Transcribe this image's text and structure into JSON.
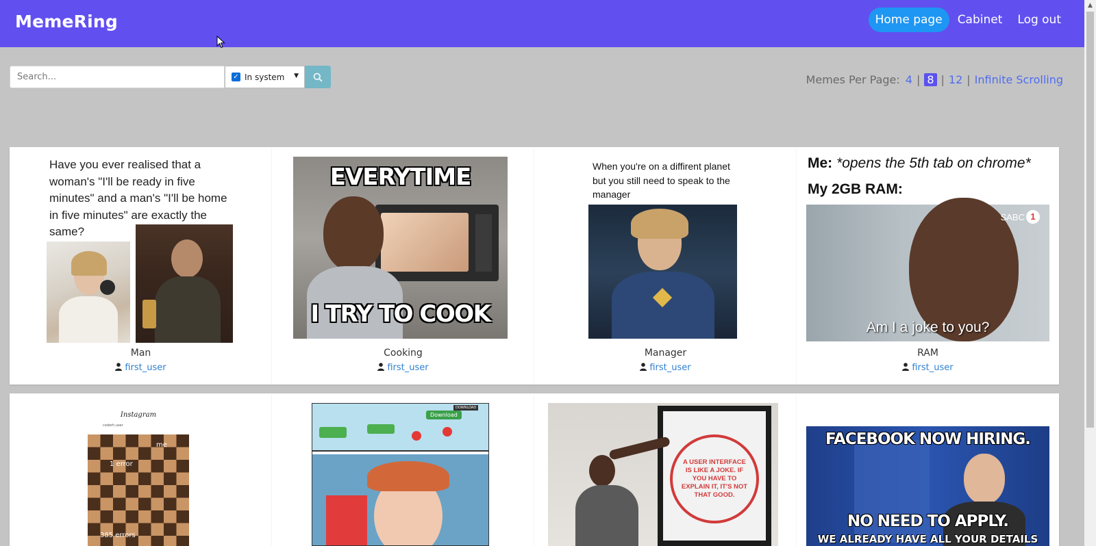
{
  "app": {
    "brand": "MemeRing"
  },
  "nav": {
    "home": "Home page",
    "cabinet": "Cabinet",
    "logout": "Log out"
  },
  "search": {
    "placeholder": "Search...",
    "filter_label": "In system"
  },
  "per_page": {
    "label": "Memes Per Page:",
    "options": [
      "4",
      "8",
      "12"
    ],
    "selected": "8",
    "infinite": "Infinite Scrolling"
  },
  "memes": [
    {
      "title": "Man",
      "author": "first_user",
      "caption": "Have you ever realised that a woman's \"I'll be ready in five minutes\" and a man's \"I'll be home in five minutes\" are exactly the same?"
    },
    {
      "title": "Cooking",
      "author": "first_user",
      "top_text": "EVERYTIME",
      "bottom_text": "I TRY TO COOK"
    },
    {
      "title": "Manager",
      "author": "first_user",
      "caption": "When you're on a diffirent planet but you still need to speak to the manager"
    },
    {
      "title": "RAM",
      "author": "first_user",
      "line1_label": "Me:",
      "line1_text": "*opens the 5th tab on chrome*",
      "line2": "My 2GB RAM:",
      "subtitle": "Am I a joke to you?",
      "channel": "SABC",
      "channel_num": "1"
    },
    {
      "app_header": "Instagram",
      "user_text": "coderh.user",
      "me_label": "me",
      "error_label": "1 error",
      "errors_label": "385 errors"
    },
    {
      "download_label": "Download",
      "sub_label": "DOWNLOAD"
    },
    {
      "poster_text": "A USER INTERFACE IS LIKE A JOKE. IF YOU HAVE TO EXPLAIN IT, IT'S NOT THAT GOOD."
    },
    {
      "top_text": "FACEBOOK NOW HIRING.",
      "bottom_text": "NO NEED TO APPLY.",
      "bottom_text2": "WE ALREADY HAVE ALL YOUR DETAILS"
    }
  ]
}
